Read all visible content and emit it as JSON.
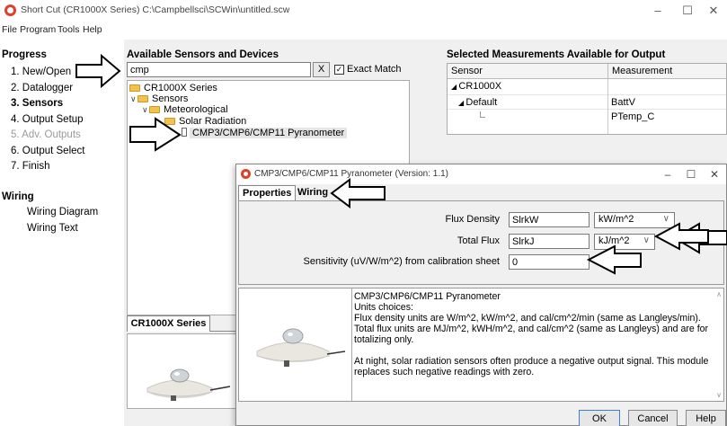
{
  "window": {
    "title": "Short Cut (CR1000X Series) C:\\Campbellsci\\SCWin\\untitled.scw",
    "controls": [
      "–",
      "☐",
      "✕"
    ]
  },
  "menu": [
    "File",
    "Program",
    "Tools",
    "Help"
  ],
  "progress": {
    "title": "Progress",
    "steps": [
      {
        "label": "1. New/Open",
        "state": "normal"
      },
      {
        "label": "2. Datalogger",
        "state": "normal"
      },
      {
        "label": "3. Sensors",
        "state": "active"
      },
      {
        "label": "4. Output Setup",
        "state": "normal"
      },
      {
        "label": "5. Adv. Outputs",
        "state": "disabled"
      },
      {
        "label": "6. Output Select",
        "state": "normal"
      },
      {
        "label": "7. Finish",
        "state": "normal"
      }
    ],
    "wiring_title": "Wiring",
    "wiring_links": [
      "Wiring Diagram",
      "Wiring Text"
    ]
  },
  "available": {
    "title": "Available Sensors and Devices",
    "search_value": "cmp",
    "clear_label": "X",
    "exact_match_label": "Exact Match",
    "exact_match_checked": true,
    "tree": {
      "root": "CR1000X Series",
      "sensors": "Sensors",
      "meteorological": "Meteorological",
      "solar": "Solar Radiation",
      "selected_sensor": "CMP3/CMP6/CMP11 Pyranometer"
    },
    "tab_label": "CR1000X Series"
  },
  "selected": {
    "title": "Selected Measurements Available for Output",
    "col_sensor": "Sensor",
    "col_measurement": "Measurement",
    "rows": {
      "logger": "CR1000X",
      "group": "Default",
      "m1": "BattV",
      "m2": "PTemp_C"
    }
  },
  "dialog": {
    "title": "CMP3/CMP6/CMP11 Pyranometer (Version: 1.1)",
    "controls": [
      "–",
      "☐",
      "✕"
    ],
    "tabs": [
      "Properties",
      "Wiring"
    ],
    "fields": {
      "flux_density_label": "Flux Density",
      "flux_density_value": "SlrkW",
      "flux_density_unit": "kW/m^2",
      "total_flux_label": "Total Flux",
      "total_flux_value": "SlrkJ",
      "total_flux_unit": "kJ/m^2",
      "sensitivity_label": "Sensitivity (uV/W/m^2) from calibration sheet",
      "sensitivity_value": "0"
    },
    "description": {
      "line1": "CMP3/CMP6/CMP11 Pyranometer",
      "line2": "Units choices:",
      "line3": "Flux density units are W/m^2, kW/m^2, and cal/cm^2/min (same as Langleys/min).",
      "line4": "Total flux units are MJ/m^2, kWH/m^2, and cal/cm^2 (same as Langleys) and are for totalizing only.",
      "line5": "At night, solar radiation sensors often produce a negative output signal. This module replaces such negative readings with zero."
    },
    "buttons": {
      "ok": "OK",
      "cancel": "Cancel",
      "help": "Help"
    }
  },
  "colors": {
    "accent_red": "#e0402a",
    "folder": "#f2c14e"
  }
}
